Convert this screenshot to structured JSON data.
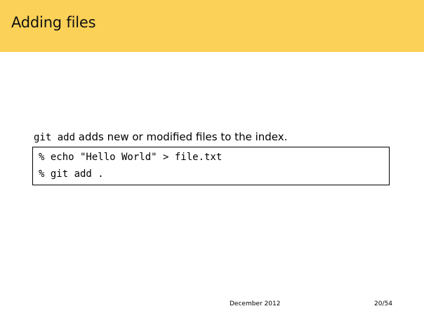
{
  "slide": {
    "title": "Adding files",
    "intro": {
      "command": "git add",
      "text": " adds new or modified files to the index."
    },
    "code_lines": [
      "% echo \"Hello World\" > file.txt",
      "% git add ."
    ]
  },
  "footer": {
    "date": "December 2012",
    "page": "20/54"
  },
  "colors": {
    "header_background": "#fcd157"
  }
}
